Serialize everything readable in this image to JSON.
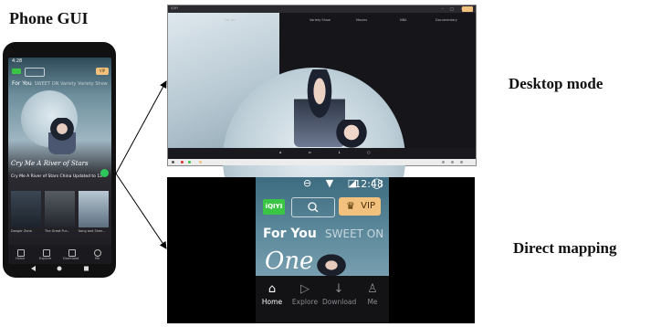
{
  "labels": {
    "phone_gui": "Phone GUI",
    "desktop_mode": "Desktop mode",
    "direct_mapping": "Direct mapping"
  },
  "phone": {
    "status_time": "4:28",
    "vip": "VIP",
    "tab_active": "For You",
    "tab_others": "SWEET ON   Variety   Variety Show",
    "hero_art": "Cry Me A River of Stars",
    "hero_caption": "Cry Me A River of Stars   China   Updated to 12",
    "cards": [
      "Danger Zone",
      "The Great Pur...",
      "Kong and Shen..."
    ],
    "nav": [
      "Home",
      "Explore",
      "Download",
      "Me"
    ]
  },
  "desktop": {
    "title": "iQIYI",
    "menu": [
      "For You",
      "Variety Show",
      "Movies",
      "NBA",
      "Documentary"
    ],
    "bottom_nav": [
      "Home",
      "Explore",
      "Download",
      "Me"
    ]
  },
  "mapping": {
    "status_time": "12:48",
    "status_icons": "⊖ ▼ ◪ ◯",
    "logo": "iQIYI",
    "vip": "VIP",
    "tab_active": "For You",
    "tab_next": "SWEET ON",
    "hero_art": "One",
    "nav": [
      {
        "label": "Home",
        "icon": "home-icon"
      },
      {
        "label": "Explore",
        "icon": "explore-icon"
      },
      {
        "label": "Download",
        "icon": "download-icon"
      },
      {
        "label": "Me",
        "icon": "person-icon"
      }
    ]
  },
  "colors": {
    "accent_green": "#3bc544",
    "vip_gold": "#f3c17e"
  }
}
